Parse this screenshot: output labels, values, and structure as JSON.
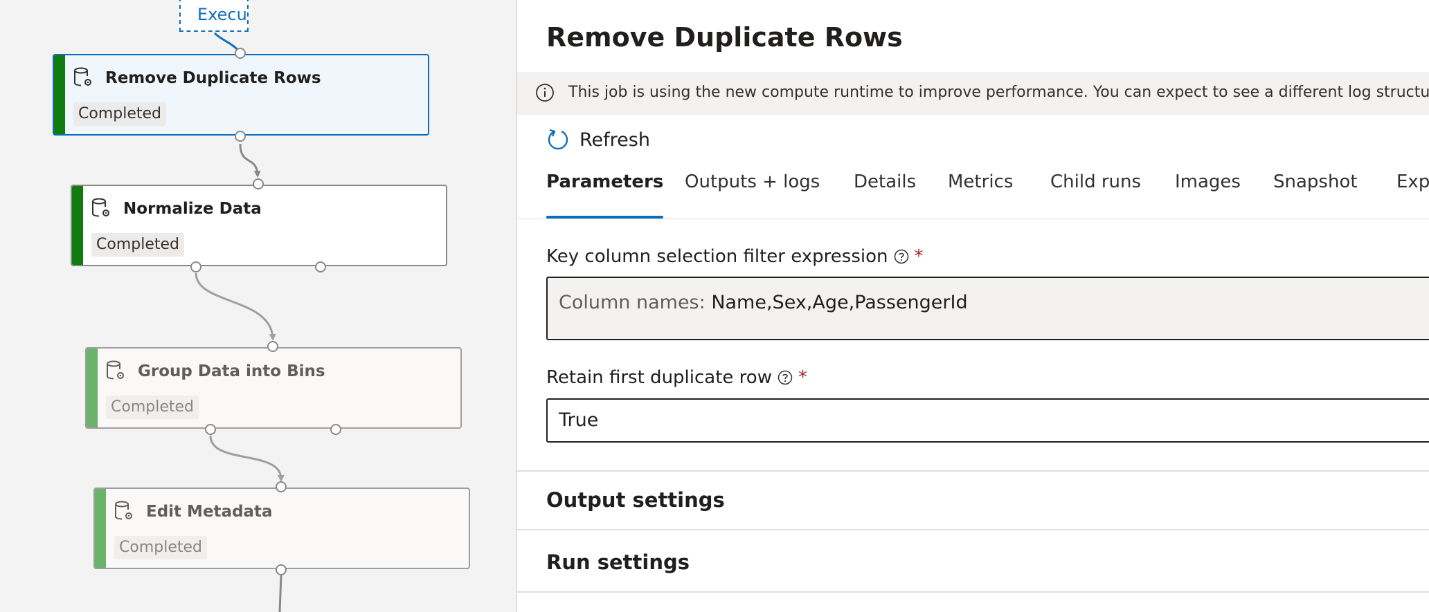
{
  "pipeline": {
    "exec_node_label": "Execu",
    "nodes": [
      {
        "title": "Remove Duplicate Rows",
        "status": "Completed"
      },
      {
        "title": "Normalize Data",
        "status": "Completed"
      },
      {
        "title": "Group Data into Bins",
        "status": "Completed"
      },
      {
        "title": "Edit Metadata",
        "status": "Completed"
      }
    ]
  },
  "panel": {
    "title": "Remove Duplicate Rows",
    "banner": "This job is using the new compute runtime to improve performance. You can expect to see a different log structure alo",
    "refresh_label": "Refresh",
    "tabs": [
      "Parameters",
      "Outputs + logs",
      "Details",
      "Metrics",
      "Child runs",
      "Images",
      "Snapshot",
      "Exp"
    ],
    "active_tab": "Parameters",
    "fields": [
      {
        "label": "Key column selection filter expression",
        "required": "*",
        "prefix": "Column names:",
        "value": "Name,Sex,Age,PassengerId"
      },
      {
        "label": "Retain first duplicate row",
        "required": "*",
        "value": "True"
      }
    ],
    "sections": [
      "Output settings",
      "Run settings"
    ]
  },
  "colors": {
    "accent": "#0f6cbd",
    "status_bar": "#107c10",
    "required": "#a4262c"
  }
}
